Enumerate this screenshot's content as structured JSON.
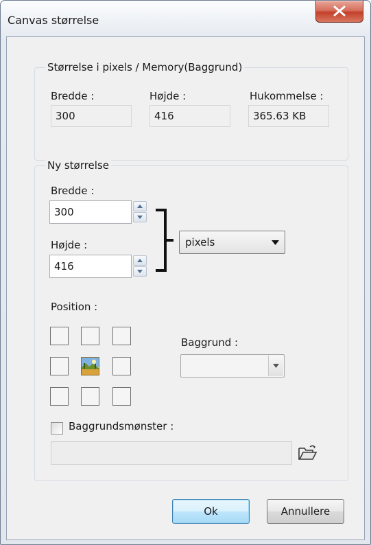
{
  "window": {
    "title": "Canvas størrelse",
    "close_icon": "close-icon"
  },
  "size_group": {
    "legend": "Størrelse i pixels / Memory(Baggrund)",
    "width_label": "Bredde :",
    "width_value": "300",
    "height_label": "Højde :",
    "height_value": "416",
    "memory_label": "Hukommelse :",
    "memory_value": "365.63 KB"
  },
  "new_size_group": {
    "legend": "Ny størrelse",
    "width_label": "Bredde :",
    "width_value": "300",
    "height_label": "Højde :",
    "height_value": "416",
    "unit_selected": "pixels",
    "position_label": "Position :",
    "anchor_selected": "center",
    "background_label": "Baggrund :",
    "background_value": "",
    "pattern_checkbox_label": "Baggrundsmønster :",
    "pattern_checked": false,
    "pattern_path": ""
  },
  "buttons": {
    "ok": "Ok",
    "cancel": "Annullere"
  },
  "colors": {
    "close_button": "#c4402b",
    "dialog_bg": "#f0f0f0",
    "default_button_border": "#3c7fb1"
  }
}
